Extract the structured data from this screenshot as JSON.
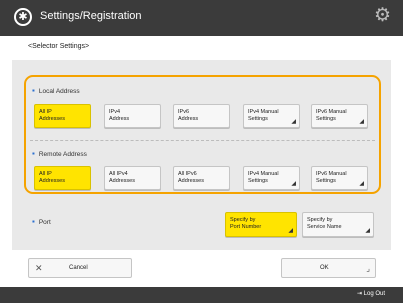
{
  "header": {
    "title": "Settings/Registration",
    "title_icon": "settings-star-icon",
    "gear_icon": "gear-icon"
  },
  "subtitle": "<Selector Settings>",
  "local_address": {
    "label": "Local Address",
    "options": [
      {
        "line1": "All IP",
        "line2": "Addresses",
        "selected": true,
        "has_more": false
      },
      {
        "line1": "IPv4",
        "line2": "Address",
        "selected": false,
        "has_more": false
      },
      {
        "line1": "IPv6",
        "line2": "Address",
        "selected": false,
        "has_more": false
      },
      {
        "line1": "IPv4 Manual",
        "line2": "Settings",
        "selected": false,
        "has_more": true
      },
      {
        "line1": "IPv6 Manual",
        "line2": "Settings",
        "selected": false,
        "has_more": true
      }
    ]
  },
  "remote_address": {
    "label": "Remote Address",
    "options": [
      {
        "line1": "All IP",
        "line2": "Addresses",
        "selected": true,
        "has_more": false
      },
      {
        "line1": "All IPv4",
        "line2": "Addresses",
        "selected": false,
        "has_more": false
      },
      {
        "line1": "All IPv6",
        "line2": "Addresses",
        "selected": false,
        "has_more": false
      },
      {
        "line1": "IPv4 Manual",
        "line2": "Settings",
        "selected": false,
        "has_more": true
      },
      {
        "line1": "IPv6 Manual",
        "line2": "Settings",
        "selected": false,
        "has_more": true
      }
    ]
  },
  "port": {
    "label": "Port",
    "options": [
      {
        "line1": "Specify by",
        "line2": "Port Number",
        "selected": true,
        "has_more": true
      },
      {
        "line1": "Specify by",
        "line2": "Service Name",
        "selected": false,
        "has_more": true
      }
    ]
  },
  "footer": {
    "cancel_label": "Cancel",
    "ok_label": "OK"
  },
  "bottom_bar": {
    "logout_label": "Log Out"
  }
}
